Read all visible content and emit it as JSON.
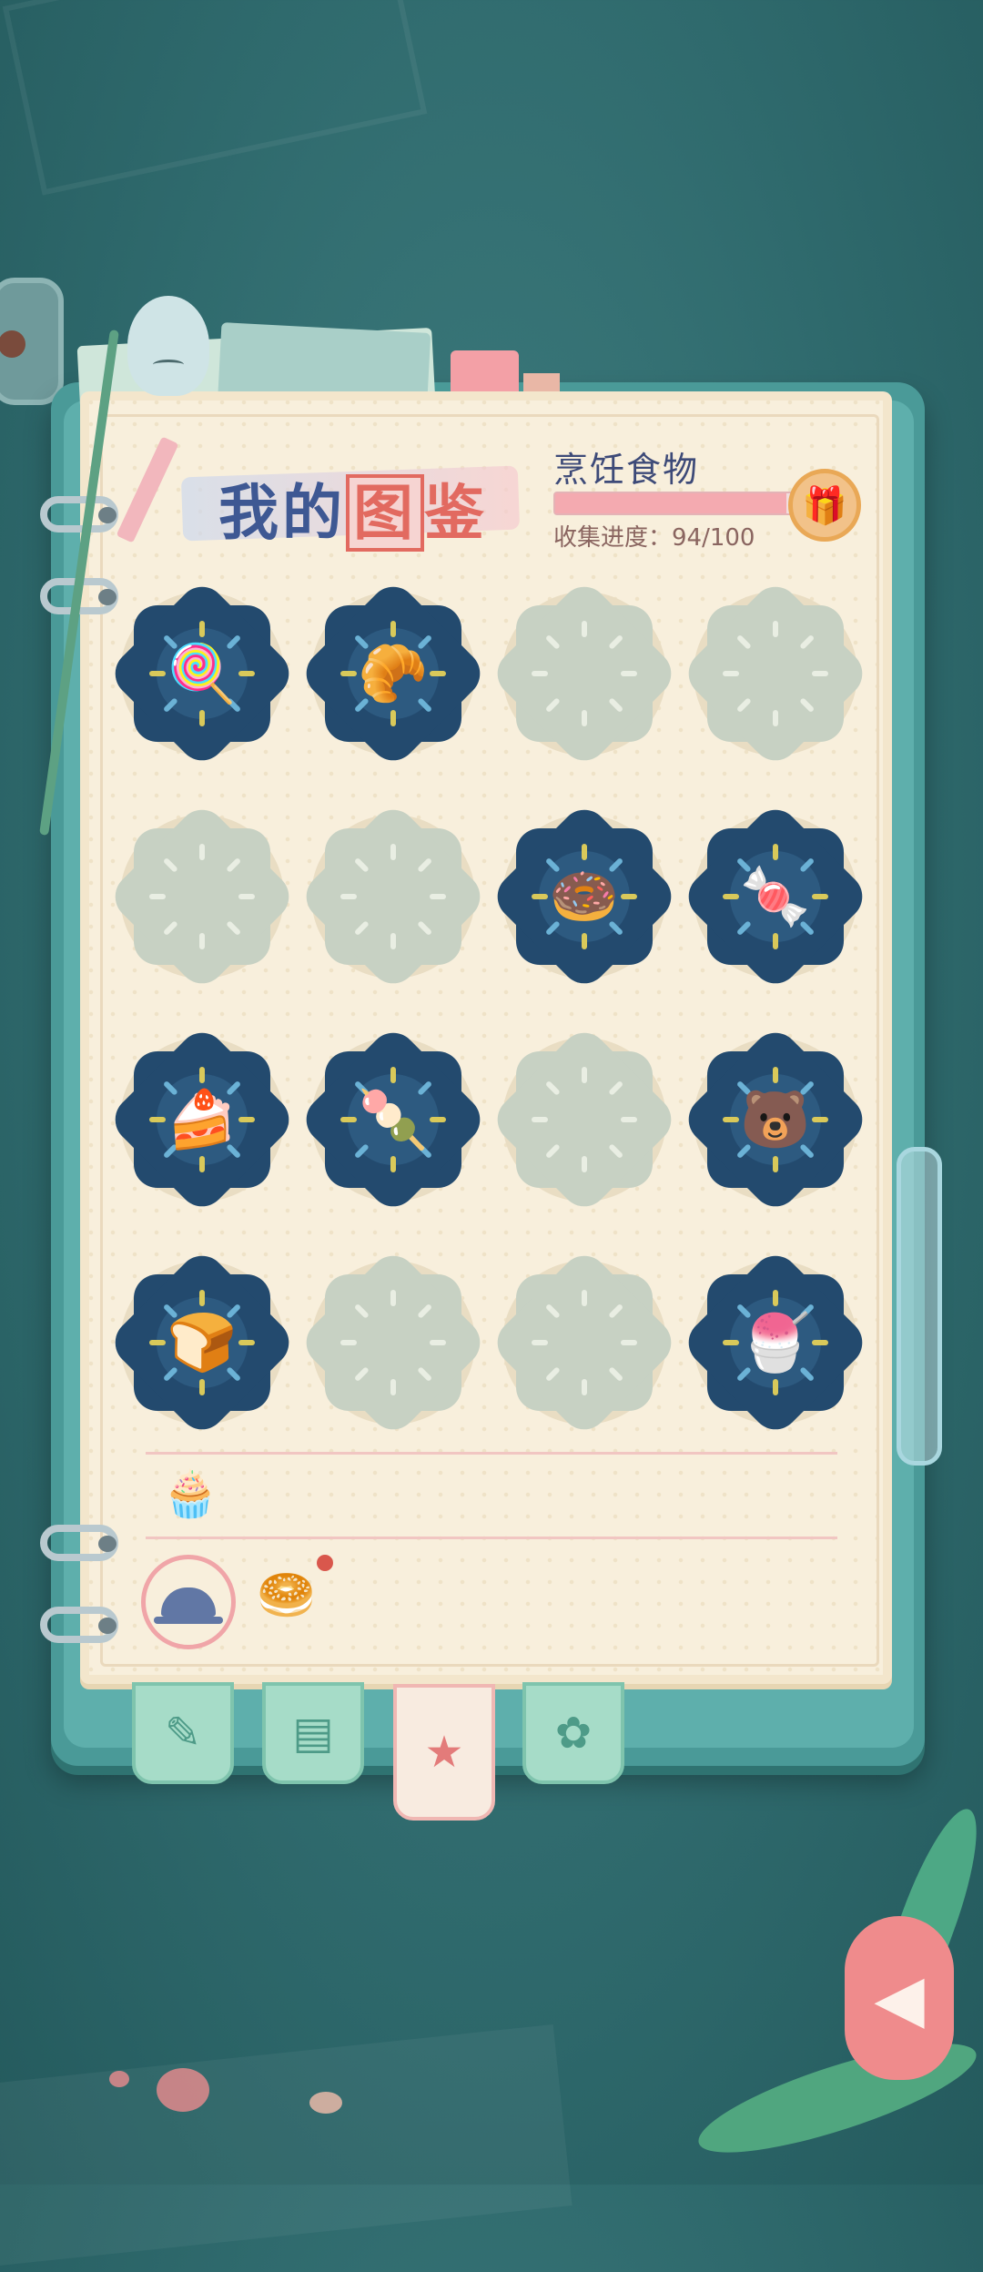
{
  "header": {
    "title_part1": "我的",
    "title_highlight": "图",
    "title_part2": "鉴",
    "category_name": "烹饪食物",
    "progress_label": "收集进度：94/100",
    "progress_value": 94,
    "progress_max": 100
  },
  "grid": {
    "rows": [
      [
        {
          "state": "filled",
          "item": "lollipop"
        },
        {
          "state": "filled",
          "item": "croissant"
        },
        {
          "state": "locked",
          "item": ""
        },
        {
          "state": "locked",
          "item": ""
        }
      ],
      [
        {
          "state": "locked",
          "item": ""
        },
        {
          "state": "locked",
          "item": ""
        },
        {
          "state": "filled",
          "item": "donut"
        },
        {
          "state": "filled",
          "item": "candy-cane"
        }
      ],
      [
        {
          "state": "filled",
          "item": "blue-cake"
        },
        {
          "state": "filled",
          "item": "cotton-candy"
        },
        {
          "state": "locked",
          "item": ""
        },
        {
          "state": "filled",
          "item": "bear-donut"
        }
      ],
      [
        {
          "state": "filled",
          "item": "star-toast"
        },
        {
          "state": "locked",
          "item": ""
        },
        {
          "state": "locked",
          "item": ""
        },
        {
          "state": "filled",
          "item": "shaved-ice"
        }
      ]
    ],
    "icons": {
      "lollipop": "🍭",
      "croissant": "🥐",
      "donut": "🍩",
      "candy-cane": "🍬",
      "blue-cake": "🍰",
      "cotton-candy": "🍡",
      "bear-donut": "🐻",
      "star-toast": "🍞",
      "shaved-ice": "🍧"
    }
  },
  "categories": {
    "items": [
      {
        "name": "dessert",
        "icon": "🧁",
        "selected": false
      },
      {
        "name": "dish",
        "icon": "cloche",
        "selected": true
      },
      {
        "name": "bakery",
        "icon": "🥯",
        "selected": false
      }
    ]
  },
  "book_tabs": [
    {
      "name": "notes",
      "icon": "✎",
      "active": false
    },
    {
      "name": "album",
      "icon": "▤",
      "active": false
    },
    {
      "name": "collection",
      "icon": "★",
      "active": true
    },
    {
      "name": "flower",
      "icon": "✿",
      "active": false
    }
  ],
  "colors": {
    "background": "#2f6a6d",
    "paper": "#f8efdc",
    "filled_slot": "#234a6e",
    "locked_slot": "#c7d1c3",
    "progress_fill": "#f4aab0",
    "title": "#3e5893",
    "accent": "#e26a60"
  }
}
